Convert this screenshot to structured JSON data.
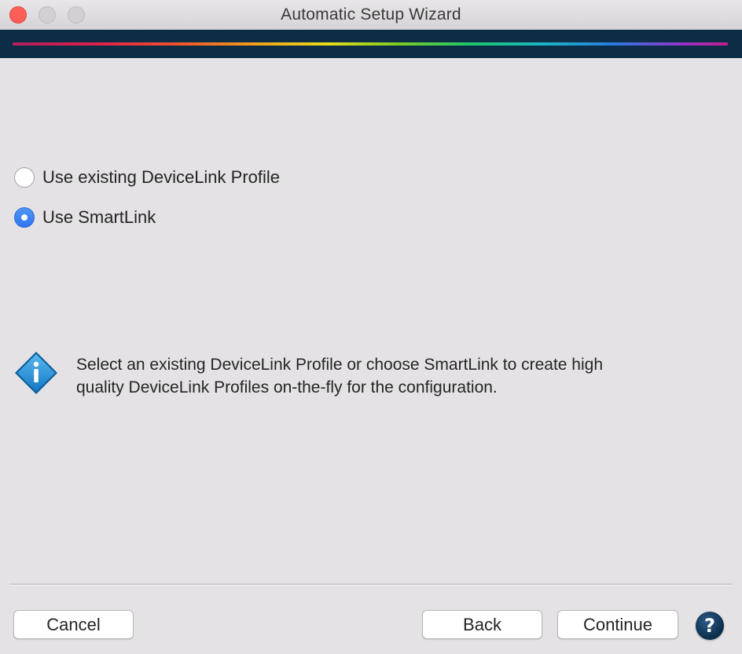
{
  "window": {
    "title": "Automatic Setup Wizard",
    "controls": [
      "close-icon",
      "minimize-icon",
      "zoom-icon"
    ]
  },
  "options": [
    {
      "label": "Use existing DeviceLink Profile",
      "selected": false
    },
    {
      "label": "Use SmartLink",
      "selected": true
    }
  ],
  "info": {
    "icon": "info-icon",
    "line1": "Select an existing DeviceLink Profile or choose SmartLink to create high",
    "line2": "quality DeviceLink Profiles on-the-fly for the configuration."
  },
  "buttons": {
    "cancel": "Cancel",
    "back": "Back",
    "continue": "Continue",
    "help": "?"
  },
  "colors": {
    "banner": "#0c2d45",
    "radio_selected": "#3b82f6",
    "close": "#fc5f57",
    "info_icon": "#1f8fd6"
  }
}
